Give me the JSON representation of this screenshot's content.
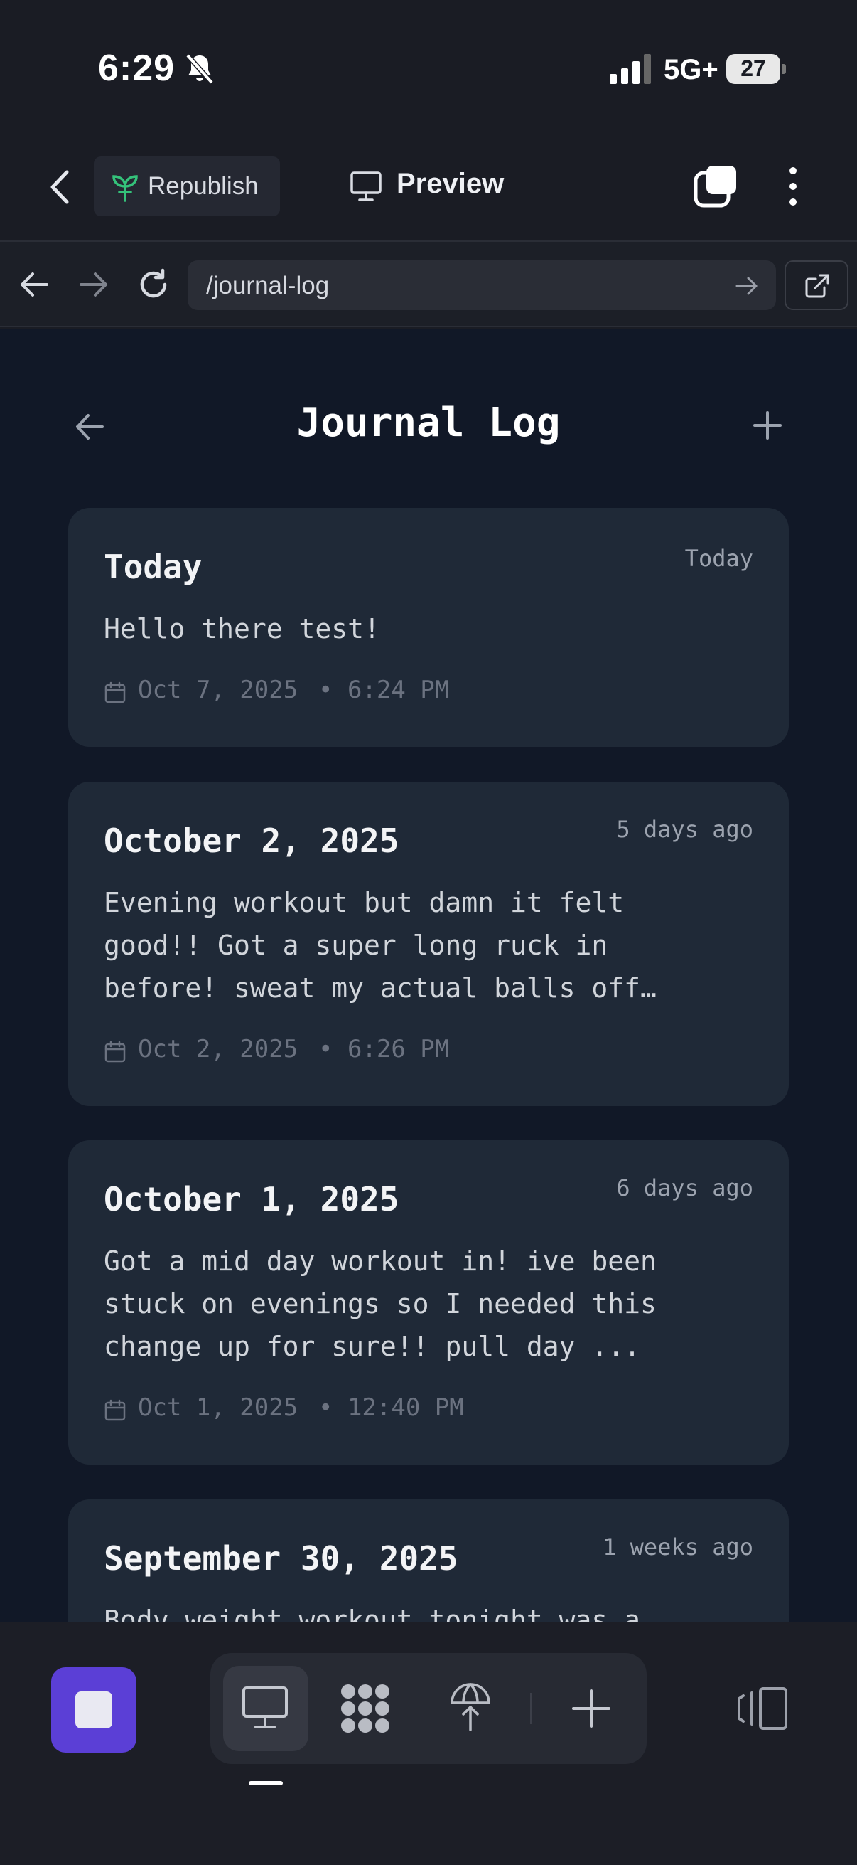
{
  "status_bar": {
    "time": "6:29",
    "network": "5G+",
    "battery": "27"
  },
  "toolbar": {
    "republish_label": "Republish",
    "preview_label": "Preview"
  },
  "browser": {
    "url": "/journal-log"
  },
  "app": {
    "title": "Journal Log",
    "entries": [
      {
        "title": "Today",
        "relative": "Today",
        "body": "Hello there test!",
        "date": "Oct 7, 2025",
        "time": "• 6:24 PM"
      },
      {
        "title": "October 2, 2025",
        "relative": "5 days ago",
        "body": "Evening workout but damn it felt\ngood!! Got a super long ruck in\nbefore! sweat my actual balls off…",
        "date": "Oct 2, 2025",
        "time": "• 6:26 PM"
      },
      {
        "title": "October 1, 2025",
        "relative": "6 days ago",
        "body": "Got a mid day workout in! ive been\nstuck on evenings so I needed this\nchange up for sure!! pull day ...",
        "date": "Oct 1, 2025",
        "time": "• 12:40 PM"
      },
      {
        "title": "September 30, 2025",
        "relative": "1 weeks ago",
        "body": "Body weight workout tonight was a"
      }
    ]
  },
  "icons": {
    "status": [
      "bell-slash-icon",
      "signal-icon",
      "battery-icon"
    ],
    "toolbar": [
      "chevron-left-icon",
      "sprout-icon",
      "monitor-icon",
      "tabs-icon",
      "more-vertical-icon"
    ],
    "browser": [
      "arrow-left-icon",
      "arrow-right-icon",
      "reload-icon",
      "go-arrow-icon",
      "external-link-icon"
    ],
    "bottom": [
      "stop-icon",
      "monitor-icon",
      "apps-icon",
      "publish-icon",
      "plus-icon",
      "panel-icon"
    ]
  },
  "colors": {
    "accent": "#5b3fd6",
    "card": "#1f2937",
    "app_bg": "#111827"
  }
}
